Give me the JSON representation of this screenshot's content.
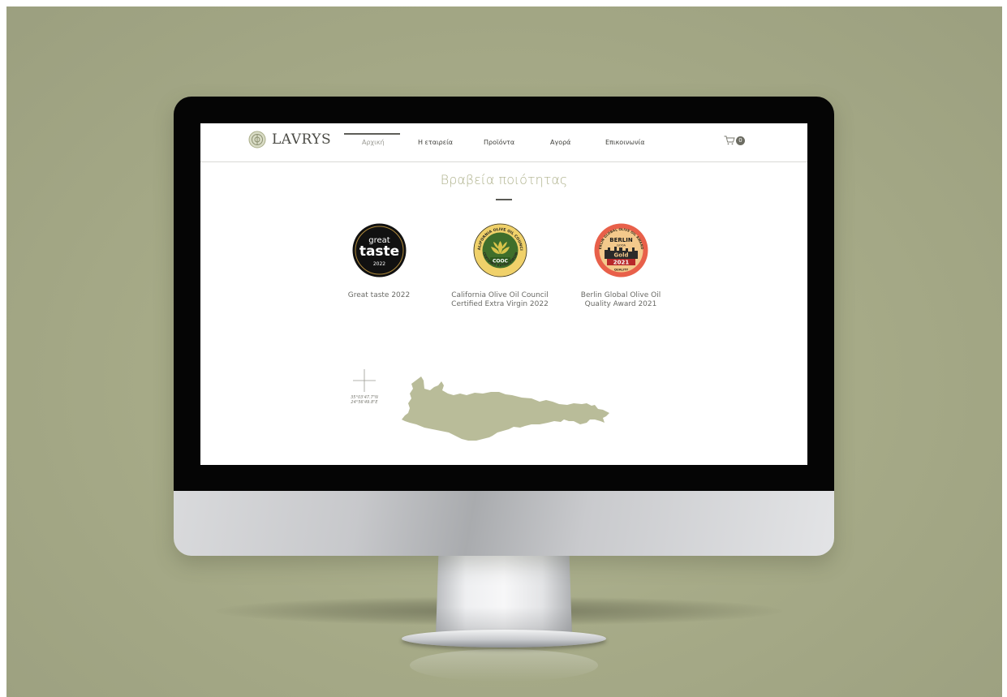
{
  "brand": {
    "name": "LAVRYS"
  },
  "nav": {
    "items": [
      {
        "label": "Αρχική",
        "active": true
      },
      {
        "label": "Η εταιρεία",
        "active": false
      },
      {
        "label": "Προϊόντα",
        "active": false
      },
      {
        "label": "Αγορά",
        "active": false
      },
      {
        "label": "Επικοινωνία",
        "active": false
      }
    ]
  },
  "cart": {
    "count": "0",
    "icon": "cart-icon"
  },
  "section": {
    "title": "Βραβεία ποιότητας"
  },
  "awards": [
    {
      "label_lines": [
        "Great taste 2022"
      ],
      "badge": {
        "top": "great",
        "main": "taste",
        "year": "2022"
      }
    },
    {
      "label_lines": [
        "California Olive Oil Council",
        "Certified Extra Virgin 2022"
      ],
      "badge": {
        "ring_top": "CALIFORNIA OLIVE OIL COUNCIL",
        "ring_bottom": "CERTIFIED EXTRA VIRGIN",
        "center": "COOC"
      }
    },
    {
      "label_lines": [
        "Berlin Global Olive Oil",
        "Quality Award 2021"
      ],
      "badge": {
        "ring": "BERLIN GLOBAL OLIVE OIL AWARDS",
        "city": "BERLIN",
        "sub": "GOOA",
        "medal": "Gold",
        "year": "2021",
        "bottom": "QUALITY"
      }
    }
  ],
  "map": {
    "coordinates": [
      "35°03'47.7\"N",
      "24°56'49.8\"E"
    ],
    "region": "crete-map"
  },
  "colors": {
    "accent": "#aeb18b",
    "map_fill": "#b9bc99",
    "background": "#a4a886"
  }
}
